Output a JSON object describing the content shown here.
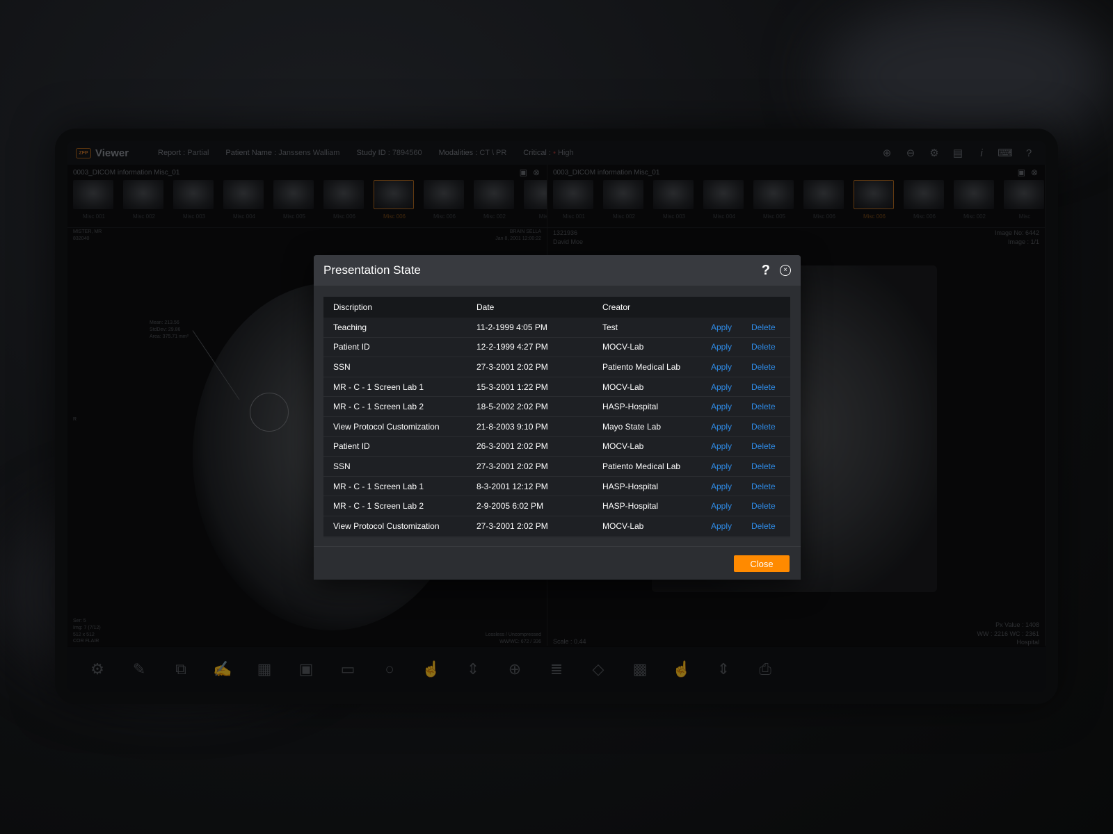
{
  "app": {
    "logo_badge": "ZFP",
    "logo_text": "Viewer"
  },
  "topbar": {
    "report_label": "Report :",
    "report_value": "Partial",
    "patient_label": "Patient Name :",
    "patient_value": "Janssens Walliam",
    "study_label": "Study ID :",
    "study_value": "7894560",
    "modalities_label": "Modalities :",
    "modalities_value": "CT \\ PR",
    "critical_label": "Critical :",
    "critical_value": "High",
    "icons": [
      "upload-icon",
      "download-icon",
      "gear-icon",
      "report-icon",
      "info-icon",
      "keyboard-icon",
      "help-icon"
    ]
  },
  "left_pane": {
    "title": "0003_DICOM information Misc_01",
    "thumbnails": [
      "Misc 001",
      "Misc 002",
      "Misc 003",
      "Misc 004",
      "Misc 005",
      "Misc 006",
      "Misc 006",
      "Misc 006",
      "Misc 002",
      "Misc"
    ],
    "selected_index": 6,
    "top_left": [
      "MISTER, MR",
      "832040"
    ],
    "top_right": [
      "BRAIN SELLA",
      "Jan 8, 2001 12:00:22"
    ],
    "measurement": [
      "Mean: 213.56",
      "StdDev: 29.86",
      "Area: 375.71 mm²"
    ],
    "orientation": "R",
    "bottom_left": [
      "Ser: 5",
      "Img: 7 (7/12)",
      "512 x 512",
      "COR FLAIR"
    ],
    "bottom_right": [
      "Lossless / Uncompressed",
      "WW/WC: 672 / 336"
    ]
  },
  "right_pane": {
    "title": "0003_DICOM information Misc_01",
    "thumbnails": [
      "Misc 001",
      "Misc 002",
      "Misc 003",
      "Misc 004",
      "Misc 005",
      "Misc 006",
      "Misc 006",
      "Misc 006",
      "Misc 002",
      "Misc"
    ],
    "selected_index": 6,
    "top_left": [
      "1321936",
      "David Moe"
    ],
    "top_right": [
      "Image No: 6442",
      "Image : 1/1"
    ],
    "bottom_left": "Scale : 0.44",
    "bottom_right": [
      "Px Value : 1408",
      "WW : 2216 WC : 2361",
      "Hospital"
    ]
  },
  "bottom_toolbar": {
    "icons": [
      "gear-icon",
      "edit-icon",
      "layers-stack-icon",
      "annotation-icon",
      "document-icon",
      "save-icon",
      "folder-icon",
      "search-icon",
      "touch-icon",
      "scroll-icon",
      "crosshair-icon",
      "stack-scroll-icon",
      "layers-icon",
      "grid-icon",
      "touch-icon",
      "scroll-icon",
      "print-icon"
    ]
  },
  "modal": {
    "title": "Presentation State",
    "help_symbol": "?",
    "close_symbol": "×",
    "columns": [
      "Discription",
      "Date",
      "Creator"
    ],
    "rows": [
      {
        "description": "Teaching",
        "date": "11-2-1999  4:05 PM",
        "creator": "Test",
        "apply": "Apply",
        "delete": "Delete"
      },
      {
        "description": "Patient ID",
        "date": "12-2-1999  4:27 PM",
        "creator": "MOCV-Lab",
        "apply": "Apply",
        "delete": "Delete"
      },
      {
        "description": "SSN",
        "date": "27-3-2001  2:02 PM",
        "creator": "Patiento Medical Lab",
        "apply": "Apply",
        "delete": "Delete"
      },
      {
        "description": "MR - C - 1 Screen Lab 1",
        "date": "15-3-2001  1:22 PM",
        "creator": "MOCV-Lab",
        "apply": "Apply",
        "delete": "Delete"
      },
      {
        "description": "MR - C - 1 Screen Lab 2",
        "date": "18-5-2002  2:02 PM",
        "creator": "HASP-Hospital",
        "apply": "Apply",
        "delete": "Delete"
      },
      {
        "description": "View Protocol Customization",
        "date": "21-8-2003  9:10 PM",
        "creator": "Mayo State Lab",
        "apply": "Apply",
        "delete": "Delete"
      },
      {
        "description": "Patient ID",
        "date": "26-3-2001  2:02 PM",
        "creator": "MOCV-Lab",
        "apply": "Apply",
        "delete": "Delete"
      },
      {
        "description": "SSN",
        "date": "27-3-2001  2:02 PM",
        "creator": "Patiento Medical Lab",
        "apply": "Apply",
        "delete": "Delete"
      },
      {
        "description": "MR - C - 1 Screen Lab 1",
        "date": "8-3-2001  12:12 PM",
        "creator": "HASP-Hospital",
        "apply": "Apply",
        "delete": "Delete"
      },
      {
        "description": "MR - C - 1 Screen Lab 2",
        "date": "2-9-2005  6:02 PM",
        "creator": "HASP-Hospital",
        "apply": "Apply",
        "delete": "Delete"
      },
      {
        "description": "View Protocol Customization",
        "date": "27-3-2001  2:02 PM",
        "creator": "MOCV-Lab",
        "apply": "Apply",
        "delete": "Delete"
      }
    ],
    "close_button": "Close"
  },
  "colors": {
    "accent": "#ff8a00",
    "link": "#2f8be6",
    "modal_bg": "#2c2e32"
  }
}
